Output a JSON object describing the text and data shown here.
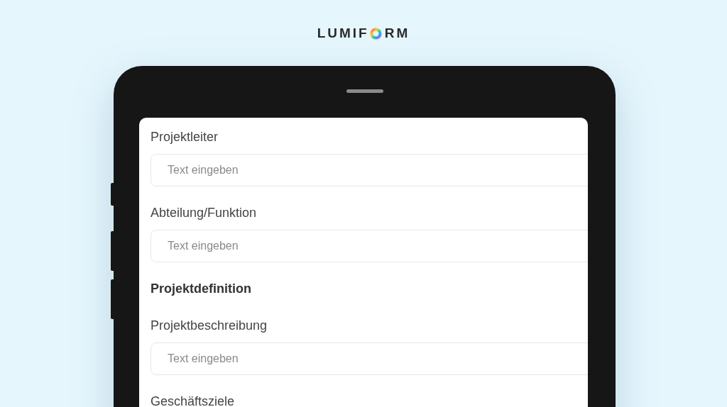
{
  "logo": {
    "text_before_ring": "LUMIF",
    "text_after_ring": "RM"
  },
  "form": [
    {
      "kind": "field",
      "label": "Projektleiter",
      "placeholder": "Text eingeben"
    },
    {
      "kind": "field",
      "label": "Abteilung/Funktion",
      "placeholder": "Text eingeben"
    },
    {
      "kind": "heading",
      "label": "Projektdefinition"
    },
    {
      "kind": "field",
      "label": "Projektbeschreibung",
      "placeholder": "Text eingeben"
    },
    {
      "kind": "field",
      "label": "Geschäftsziele"
    }
  ]
}
